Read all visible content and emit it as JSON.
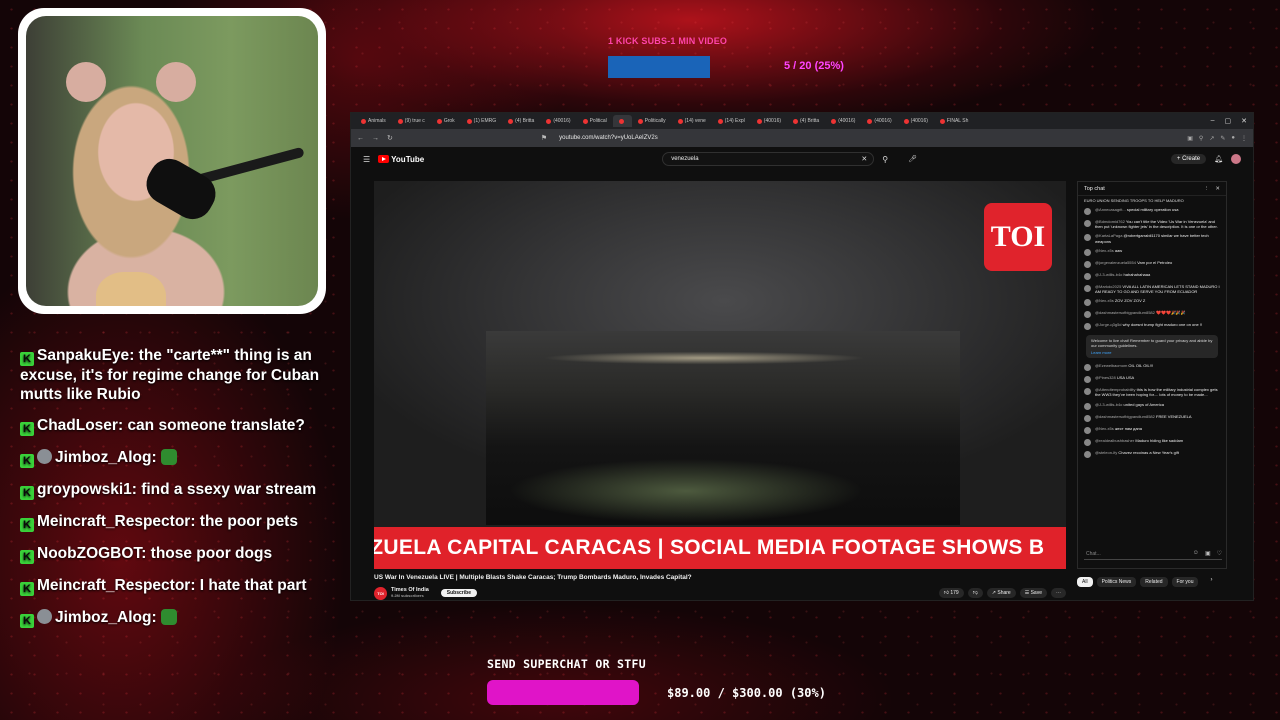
{
  "sub_goal": {
    "title": "1 KICK SUBS-1 MIN VIDEO",
    "progress_text": "5 / 20 (25%)",
    "fraction": 0.25
  },
  "chat": [
    {
      "user": "SanpakuEye",
      "text": "the \"carte**\" thing is an excuse, it's for regime change for Cuban mutts like Rubio",
      "sub": false,
      "emote": false
    },
    {
      "user": "ChadLoser",
      "text": "can someone translate?",
      "sub": false,
      "emote": false
    },
    {
      "user": "Jimboz_Alog",
      "text": "",
      "sub": true,
      "emote": true
    },
    {
      "user": "groypowski1",
      "text": "find a ssexy war stream",
      "sub": false,
      "emote": false
    },
    {
      "user": "Meincraft_Respector",
      "text": "the poor pets",
      "sub": false,
      "emote": false
    },
    {
      "user": "NoobZOGBOT",
      "text": "those poor dogs",
      "sub": false,
      "emote": false
    },
    {
      "user": "Meincraft_Respector",
      "text": "I hate that part",
      "sub": false,
      "emote": false
    },
    {
      "user": "Jimboz_Alog",
      "text": "",
      "sub": true,
      "emote": true
    }
  ],
  "browser": {
    "tabs": [
      "Animals",
      "(9) true c",
      "Grok",
      "(1) EMRG",
      "(4) Britta",
      "(40016)",
      "Political",
      "",
      "Politically",
      "(14) vene",
      "(14) Expl",
      "(40016)",
      "(4) Britta",
      "(40016)",
      "(40016)",
      "(40016)",
      "FINAL Sh"
    ],
    "url": "youtube.com/watch?v=yUoLAeIZV2s",
    "window_controls": [
      "–",
      "▢",
      "✕"
    ]
  },
  "youtube": {
    "logo": "YouTube",
    "search_value": "venezuela",
    "create_label": "+ Create",
    "video": {
      "logo_text": "TOI",
      "ticker": "EZUELA CAPITAL CARACAS | SOCIAL MEDIA FOOTAGE SHOWS B",
      "title": "US War In Venezuela LIVE | Multiple Blasts Shake Caracas; Trump Bombards Maduro, Invades Capital?",
      "channel": "Times Of India",
      "channel_subs": "9.2M subscribers",
      "subscribe": "Subscribe",
      "likes": "179",
      "share": "Share",
      "save": "Save"
    },
    "live_chat": {
      "header": "Top chat",
      "pinned": "EURO UNION SENDING TROOPS TO HELP MADURO",
      "messages": [
        {
          "name": "@Annecasagrit...",
          "text": "special military operation usa"
        },
        {
          "name": "@Bdmdomid762",
          "text": "You can't title the Video 'Us War in Venezuela' and then put 'unknown fighter jets' in the description. It is one or the other."
        },
        {
          "name": "@KartaLaPaga",
          "text": "@robertgarrabil1170 similar we have better tech weapons"
        },
        {
          "name": "@Nex-x5s",
          "text": "aaw"
        },
        {
          "name": "@jorgevalenzuela5554",
          "text": "Vam por el Petroleo"
        },
        {
          "name": "@J-3-willis-b4o",
          "text": "hahahahahaaa"
        },
        {
          "name": "@Markdo2025",
          "text": "VIVA ALL LATIN AMERICAN LETS STAND MADURO I AM READY TO GO AND SERVE YOU FROM ECUADOR"
        },
        {
          "name": "@Nex-x5s",
          "text": "ZOV ZOV ZOV Z"
        },
        {
          "name": "@dashmastersofbigpandlum8582",
          "text": "❤️❤️❤️🎉🎉🎉"
        },
        {
          "name": "@Jorge-q3g5d",
          "text": "why doesnt trump fight maduro one on one !!"
        }
      ],
      "notice": "Welcome to live chat! Remember to guard your privacy and abide by our community guidelines.",
      "learn_more": "Learn more",
      "messages2": [
        {
          "name": "@Ezewelbacmom",
          "text": "OIL OIL OIL!!!"
        },
        {
          "name": "@Pines328",
          "text": "USA USA"
        },
        {
          "name": "@Attendtemprobability",
          "text": "this is how the military industrial complex gets the WW3 they've been hoping for.... lots of money to be made..."
        },
        {
          "name": "@J-3-willis-b4o",
          "text": "united gays of America"
        },
        {
          "name": "@dashmastersofbigpandlum8582",
          "text": "FREE VENEZUELA"
        },
        {
          "name": "@Nex-x5s",
          "text": "жест нам дана"
        },
        {
          "name": "@realdealbushbasher",
          "text": "Maduro hiding like saddam"
        },
        {
          "name": "@steleon-lfy",
          "text": "Chavez recoinas a New Year's gift"
        }
      ],
      "input_placeholder": "Chat..."
    },
    "chips": [
      "All",
      "Politics News",
      "Related",
      "For you"
    ]
  },
  "superchat_goal": {
    "title": "SEND SUPERCHAT OR STFU",
    "progress_text": "$89.00 / $300.00 (30%)",
    "fraction": 0.3
  },
  "colors": {
    "kick_green": "#3ad23a",
    "youtube_red": "#ff0000",
    "ticker_red": "#e0222a",
    "superchat_pink": "#e014c8",
    "sub_goal_blue": "#1a64b8"
  }
}
